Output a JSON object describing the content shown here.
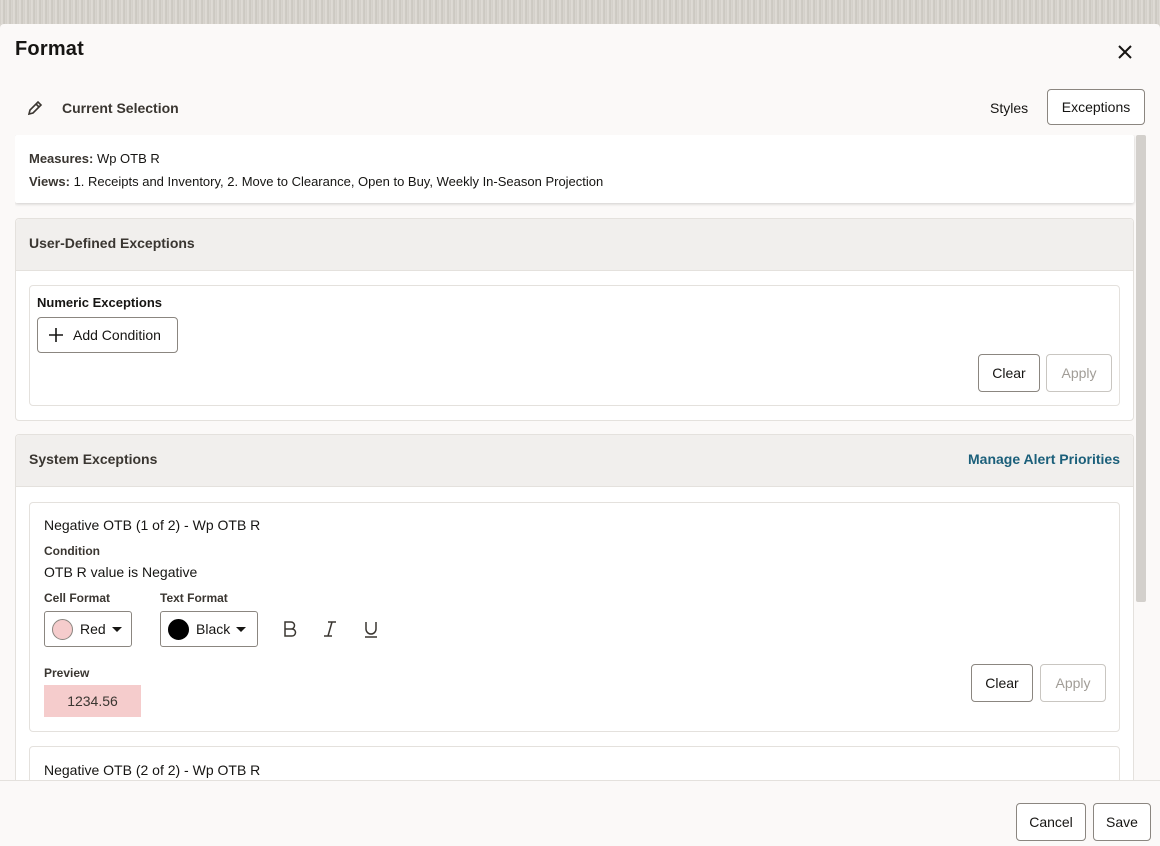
{
  "dialog": {
    "title": "Format",
    "close_icon": "close-icon"
  },
  "selection": {
    "label": "Current Selection",
    "icon": "pencil-icon",
    "styles_label": "Styles",
    "exceptions_label": "Exceptions"
  },
  "info": {
    "measures_label": "Measures:",
    "measures_value": "Wp OTB R",
    "views_label": "Views:",
    "views_value": "1. Receipts and Inventory, 2. Move to Clearance, Open to Buy, Weekly In-Season Projection"
  },
  "user_defined": {
    "title": "User-Defined Exceptions",
    "numeric_title": "Numeric Exceptions",
    "add_condition_label": "Add Condition",
    "clear_label": "Clear",
    "apply_label": "Apply"
  },
  "system": {
    "title": "System Exceptions",
    "manage_label": "Manage Alert Priorities",
    "exceptions": [
      {
        "title": "Negative OTB (1 of 2) - Wp OTB R",
        "condition_label": "Condition",
        "condition_text": "OTB R value is Negative",
        "cell_format_label": "Cell Format",
        "cell_format_value": "Red",
        "cell_format_color": "#f5cccc",
        "text_format_label": "Text Format",
        "text_format_value": "Black",
        "text_format_color": "#000000",
        "preview_label": "Preview",
        "preview_value": "1234.56",
        "preview_bg": "#f5cccc",
        "clear_label": "Clear",
        "apply_label": "Apply"
      },
      {
        "title": "Negative OTB (2 of 2) - Wp OTB R"
      }
    ]
  },
  "footer": {
    "cancel_label": "Cancel",
    "save_label": "Save"
  },
  "colors": {
    "link": "#1b5f7a",
    "dialog_bg": "#fbf9f8"
  }
}
